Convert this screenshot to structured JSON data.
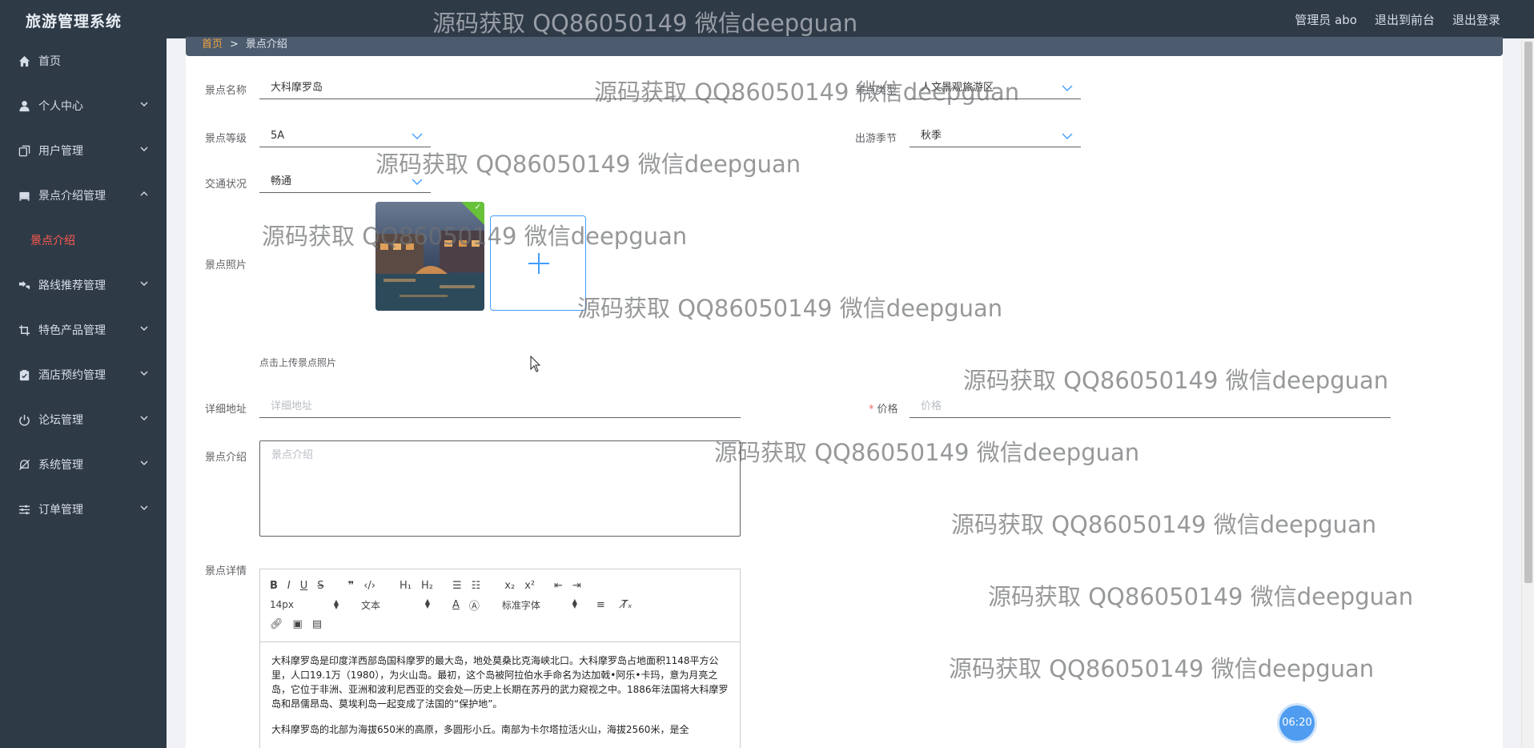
{
  "app": {
    "title": "旅游管理系统"
  },
  "header": {
    "user": "管理员 abo",
    "to_front": "退出到前台",
    "logout": "退出登录"
  },
  "sidebar": {
    "items": [
      {
        "label": "首页",
        "icon": "home-icon"
      },
      {
        "label": "个人中心",
        "icon": "user-icon"
      },
      {
        "label": "用户管理",
        "icon": "copy-icon"
      },
      {
        "label": "景点介绍管理",
        "icon": "bed-icon"
      },
      {
        "label": "路线推荐管理",
        "icon": "route-icon"
      },
      {
        "label": "特色产品管理",
        "icon": "crop-icon"
      },
      {
        "label": "酒店预约管理",
        "icon": "hotel-icon"
      },
      {
        "label": "论坛管理",
        "icon": "power-icon"
      },
      {
        "label": "系统管理",
        "icon": "bell-off-icon"
      },
      {
        "label": "订单管理",
        "icon": "sliders-icon"
      }
    ],
    "sub_active": "景点介绍"
  },
  "breadcrumb": {
    "home": "首页",
    "sep": ">",
    "current": "景点介绍"
  },
  "form": {
    "name_label": "景点名称",
    "name_value": "大科摩罗岛",
    "type_label": "景点类型",
    "type_value": "人文景观旅游区",
    "level_label": "景点等级",
    "level_value": "5A",
    "season_label": "出游季节",
    "season_value": "秋季",
    "traffic_label": "交通状况",
    "traffic_value": "畅通",
    "photo_label": "景点照片",
    "photo_hint": "点击上传景点照片",
    "address_label": "详细地址",
    "address_placeholder": "详细地址",
    "price_label": "价格",
    "price_required": "*",
    "price_placeholder": "价格",
    "intro_label": "景点介绍",
    "intro_placeholder": "景点介绍",
    "detail_label": "景点详情"
  },
  "editor": {
    "font_size": "14px",
    "text_type": "文本",
    "font_family": "标准字体",
    "paragraphs": [
      "大科摩罗岛是印度洋西部岛国科摩罗的最大岛，地处莫桑比克海峡北口。大科摩罗岛占地面积1148平方公里，人口19.1万（1980），为火山岛。最初，这个岛被阿拉伯水手命名为达加戟•阿乐•卡玛，意为月亮之岛，它位于非洲、亚洲和波利尼西亚的交会处—历史上长期在苏丹的武力窥视之中。1886年法国将大科摩罗岛和昂儒昂岛、莫埃利岛一起变成了法国的“保护地”。",
      "大科摩罗岛的北部为海拔650米的高原，多圆形小丘。南部为卡尔塔拉活火山，海拔2560米，是全"
    ]
  },
  "watermark": "源码获取 QQ86050149 微信deepguan",
  "timer": "06:20",
  "colors": {
    "sidebar_bg": "#2f3a47",
    "accent": "#409eff",
    "active": "#ff5a4f"
  }
}
